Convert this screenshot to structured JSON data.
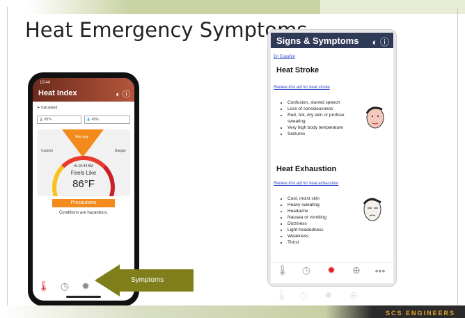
{
  "slide": {
    "title": "Heat Emergency Symptoms",
    "brand": "SCS ENGINEERS"
  },
  "left_phone": {
    "time": "10:44",
    "app_title": "Heat Index",
    "location": "Calculated",
    "temperature_reading": "85°F",
    "humidity_reading": "45%",
    "gauge_warning": "Warning",
    "gauge_caution": "Caution",
    "gauge_danger": "Danger",
    "at_time": "At 10:44 AM",
    "feels_like_label": "Feels Like",
    "feels_like_value": "86°F",
    "precautions_button": "Precautions",
    "conditions_text": "Conditions are hazardous.",
    "tabs": [
      {
        "label": "Heat Index",
        "icon": "thermometer-icon"
      },
      {
        "label": "History",
        "icon": "clock-icon"
      },
      {
        "label": "Symptoms",
        "icon": "alert-icon"
      }
    ]
  },
  "callout": {
    "label": "Symptoms"
  },
  "right_phone": {
    "title": "Signs & Symptoms",
    "espanol_link": "En Español",
    "heat_stroke": {
      "heading": "Heat Stroke",
      "link": "Review first aid for heat stroke",
      "symptoms": [
        "Confusion, slurred speech",
        "Loss of consciousness",
        "Red, hot, dry skin or profuse sweating",
        "Very high body temperature",
        "Seizures"
      ]
    },
    "heat_exhaustion": {
      "heading": "Heat Exhaustion",
      "link": "Review first aid for heat exhaustion",
      "symptoms": [
        "Cool, moist skin",
        "Heavy sweating",
        "Headache",
        "Nausea or vomiting",
        "Dizziness",
        "Light-headedness",
        "Weakness",
        "Thirst"
      ]
    },
    "tabs": [
      {
        "label": "Heat Index",
        "icon": "thermometer-icon"
      },
      {
        "label": "History",
        "icon": "clock-icon"
      },
      {
        "label": "Symptoms",
        "icon": "alert-icon"
      },
      {
        "label": "First Aid",
        "icon": "first-aid-icon"
      },
      {
        "label": "More",
        "icon": "more-icon"
      }
    ]
  },
  "colors": {
    "accent_orange": "#f28a1c",
    "callout_olive": "#7f7e1a",
    "header_navy": "#2f3a56",
    "link_blue": "#2d44c4"
  }
}
